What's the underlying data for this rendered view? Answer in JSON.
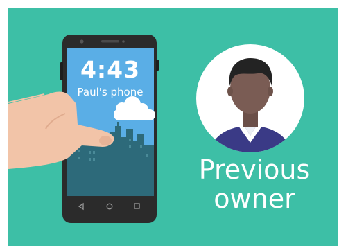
{
  "lock_screen": {
    "time": "4:43",
    "device_name": "Paul's phone"
  },
  "caption": {
    "line1": "Previous",
    "line2": "owner"
  },
  "nav_buttons": [
    "back-icon",
    "home-icon",
    "recents-icon"
  ],
  "colors": {
    "background": "#3dbfa6",
    "screen_sky": "#5aaee6",
    "city": "#2d6a7a",
    "phone_body": "#2b2b2b",
    "text": "#ffffff"
  }
}
